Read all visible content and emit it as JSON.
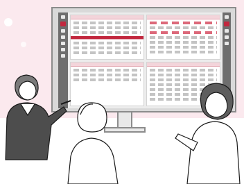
{
  "scene": {
    "background": "#fbe9ee",
    "accent": "#c2273e",
    "description_icons": [
      "monitor-icon",
      "person-icon"
    ]
  },
  "dashboard": {
    "panels": 4,
    "theme_color": "#c2273e"
  }
}
